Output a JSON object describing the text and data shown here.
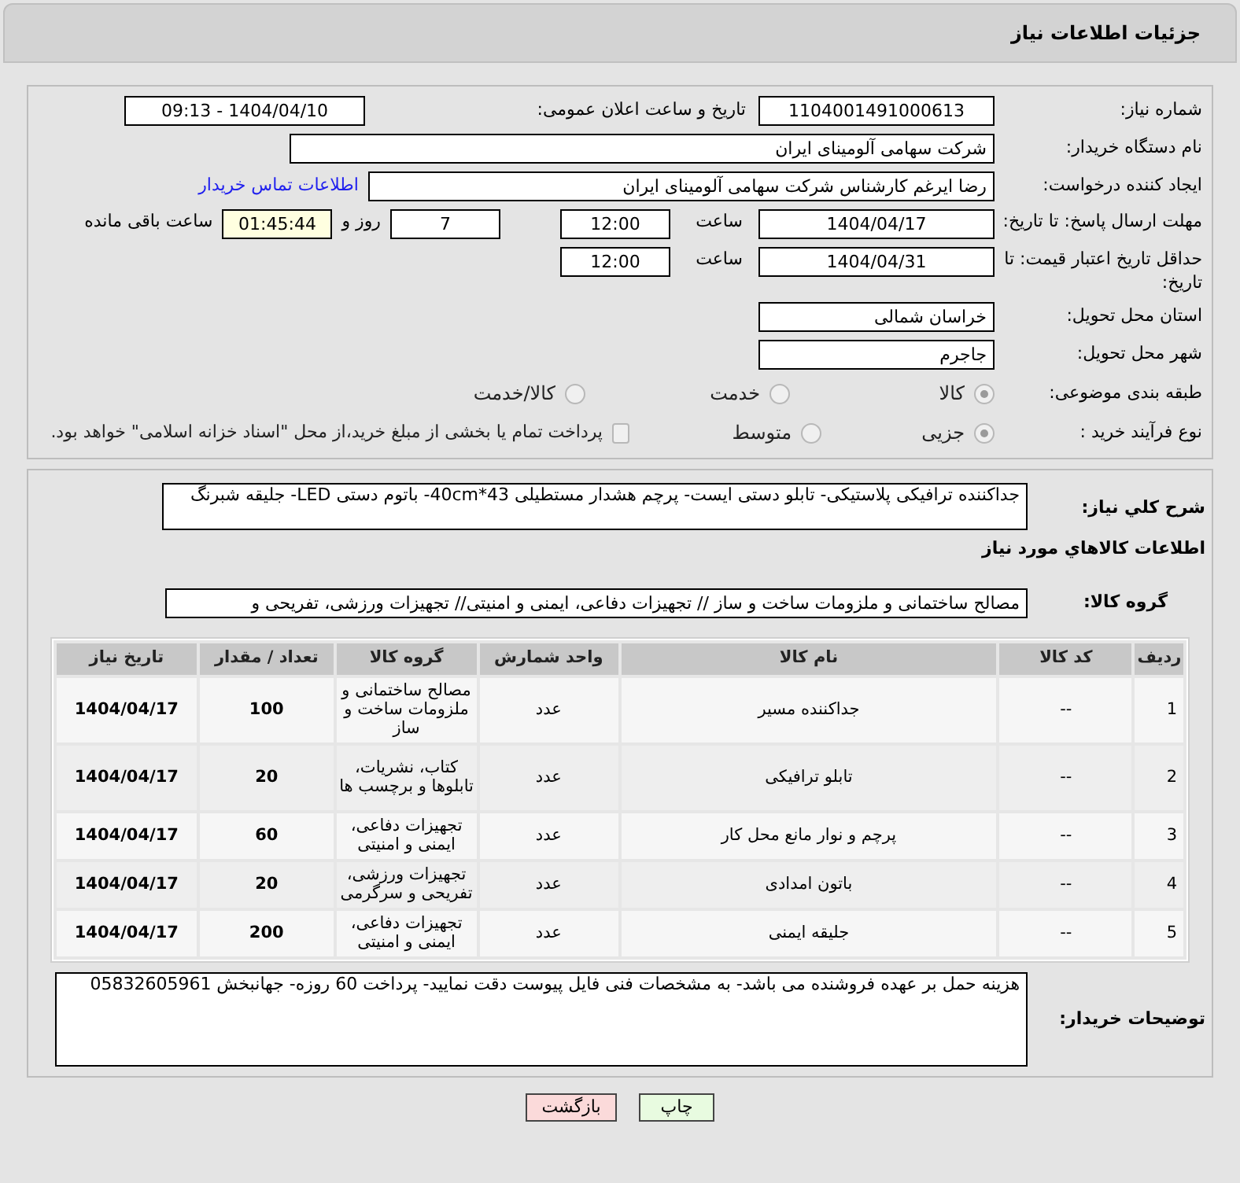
{
  "header": {
    "title": "جزئیات اطلاعات نیاز"
  },
  "need_number": {
    "label": "شماره نیاز:",
    "value": "1104001491000613"
  },
  "announce": {
    "label": "تاریخ و ساعت اعلان عمومی:",
    "value": "1404/04/10 - 09:13"
  },
  "buyer_org": {
    "label": "نام دستگاه خریدار:",
    "value": "شرکت سهامی آلومینای ایران"
  },
  "requester": {
    "label": "ایجاد کننده درخواست:",
    "value": "رضا ایرغم کارشناس شرکت سهامی آلومینای ایران",
    "link": "اطلاعات تماس خریدار"
  },
  "response_deadline": {
    "label": "مهلت ارسال پاسخ: تا تاریخ:",
    "date": "1404/04/17",
    "time_label": "ساعت",
    "time": "12:00",
    "days": "7",
    "days_label": "روز و",
    "remaining": "01:45:44",
    "remaining_label": "ساعت باقی مانده"
  },
  "price_validity": {
    "label": "حداقل تاریخ اعتبار قیمت: تا تاریخ:",
    "date": "1404/04/31",
    "time_label": "ساعت",
    "time": "12:00"
  },
  "province": {
    "label": "استان محل تحویل:",
    "value": "خراسان شمالی"
  },
  "city": {
    "label": "شهر محل تحویل:",
    "value": "جاجرم"
  },
  "category": {
    "label": "طبقه بندی موضوعی:",
    "options": [
      {
        "label": "کالا",
        "selected": true
      },
      {
        "label": "خدمت",
        "selected": false
      },
      {
        "label": "کالا/خدمت",
        "selected": false
      }
    ]
  },
  "process": {
    "label": "نوع فرآیند خرید :",
    "options": [
      {
        "label": "جزیی",
        "selected": true
      },
      {
        "label": "متوسط",
        "selected": false
      }
    ],
    "payment": {
      "label": "پرداخت تمام یا بخشی از مبلغ خرید،از محل \"اسناد خزانه اسلامی\" خواهد بود.",
      "checked": false
    }
  },
  "description": {
    "label": "شرح کلي نياز:",
    "value": "جداکننده ترافیکی پلاستیکی- تابلو دستی ایست- پرچم هشدار مستطیلی 43*40cm- باتوم دستی LED- جلیقه شبرنگ"
  },
  "items_title": "اطلاعات کالاهاي مورد نياز",
  "goods_group": {
    "label": "گروه کالا:",
    "value": "مصالح ساختمانی و ملزومات ساخت و ساز // تجهیزات دفاعی، ایمنی و امنیتی// تجهیزات ورزشی، تفریحی و"
  },
  "table": {
    "columns": [
      "ردیف",
      "کد کالا",
      "نام کالا",
      "واحد شمارش",
      "گروه کالا",
      "تعداد / مقدار",
      "تاریخ نیاز"
    ],
    "rows": [
      [
        "1",
        "--",
        "جداکننده مسیر",
        "عدد",
        "مصالح ساختمانی و ملزومات ساخت و ساز",
        "100",
        "1404/04/17"
      ],
      [
        "2",
        "--",
        "تابلو ترافیکی",
        "عدد",
        "کتاب، نشریات، تابلوها و برچسب ها",
        "20",
        "1404/04/17"
      ],
      [
        "3",
        "--",
        "پرچم و نوار مانع محل کار",
        "عدد",
        "تجهیزات دفاعی، ایمنی و امنیتی",
        "60",
        "1404/04/17"
      ],
      [
        "4",
        "--",
        "باتون امدادی",
        "عدد",
        "تجهیزات ورزشی، تفریحی و سرگرمی",
        "20",
        "1404/04/17"
      ],
      [
        "5",
        "--",
        "جلیقه ایمنی",
        "عدد",
        "تجهیزات دفاعی، ایمنی و امنیتی",
        "200",
        "1404/04/17"
      ]
    ]
  },
  "buyer_notes": {
    "label": "توضیحات خریدار:",
    "value": "هزینه حمل بر عهده فروشنده می باشد- به مشخصات فنی فایل پیوست دقت نمایید- پرداخت 60 روزه- جهانبخش 05832605961"
  },
  "buttons": [
    {
      "label": "چاپ",
      "kind": "print"
    },
    {
      "label": "بازگشت",
      "kind": "back"
    }
  ]
}
